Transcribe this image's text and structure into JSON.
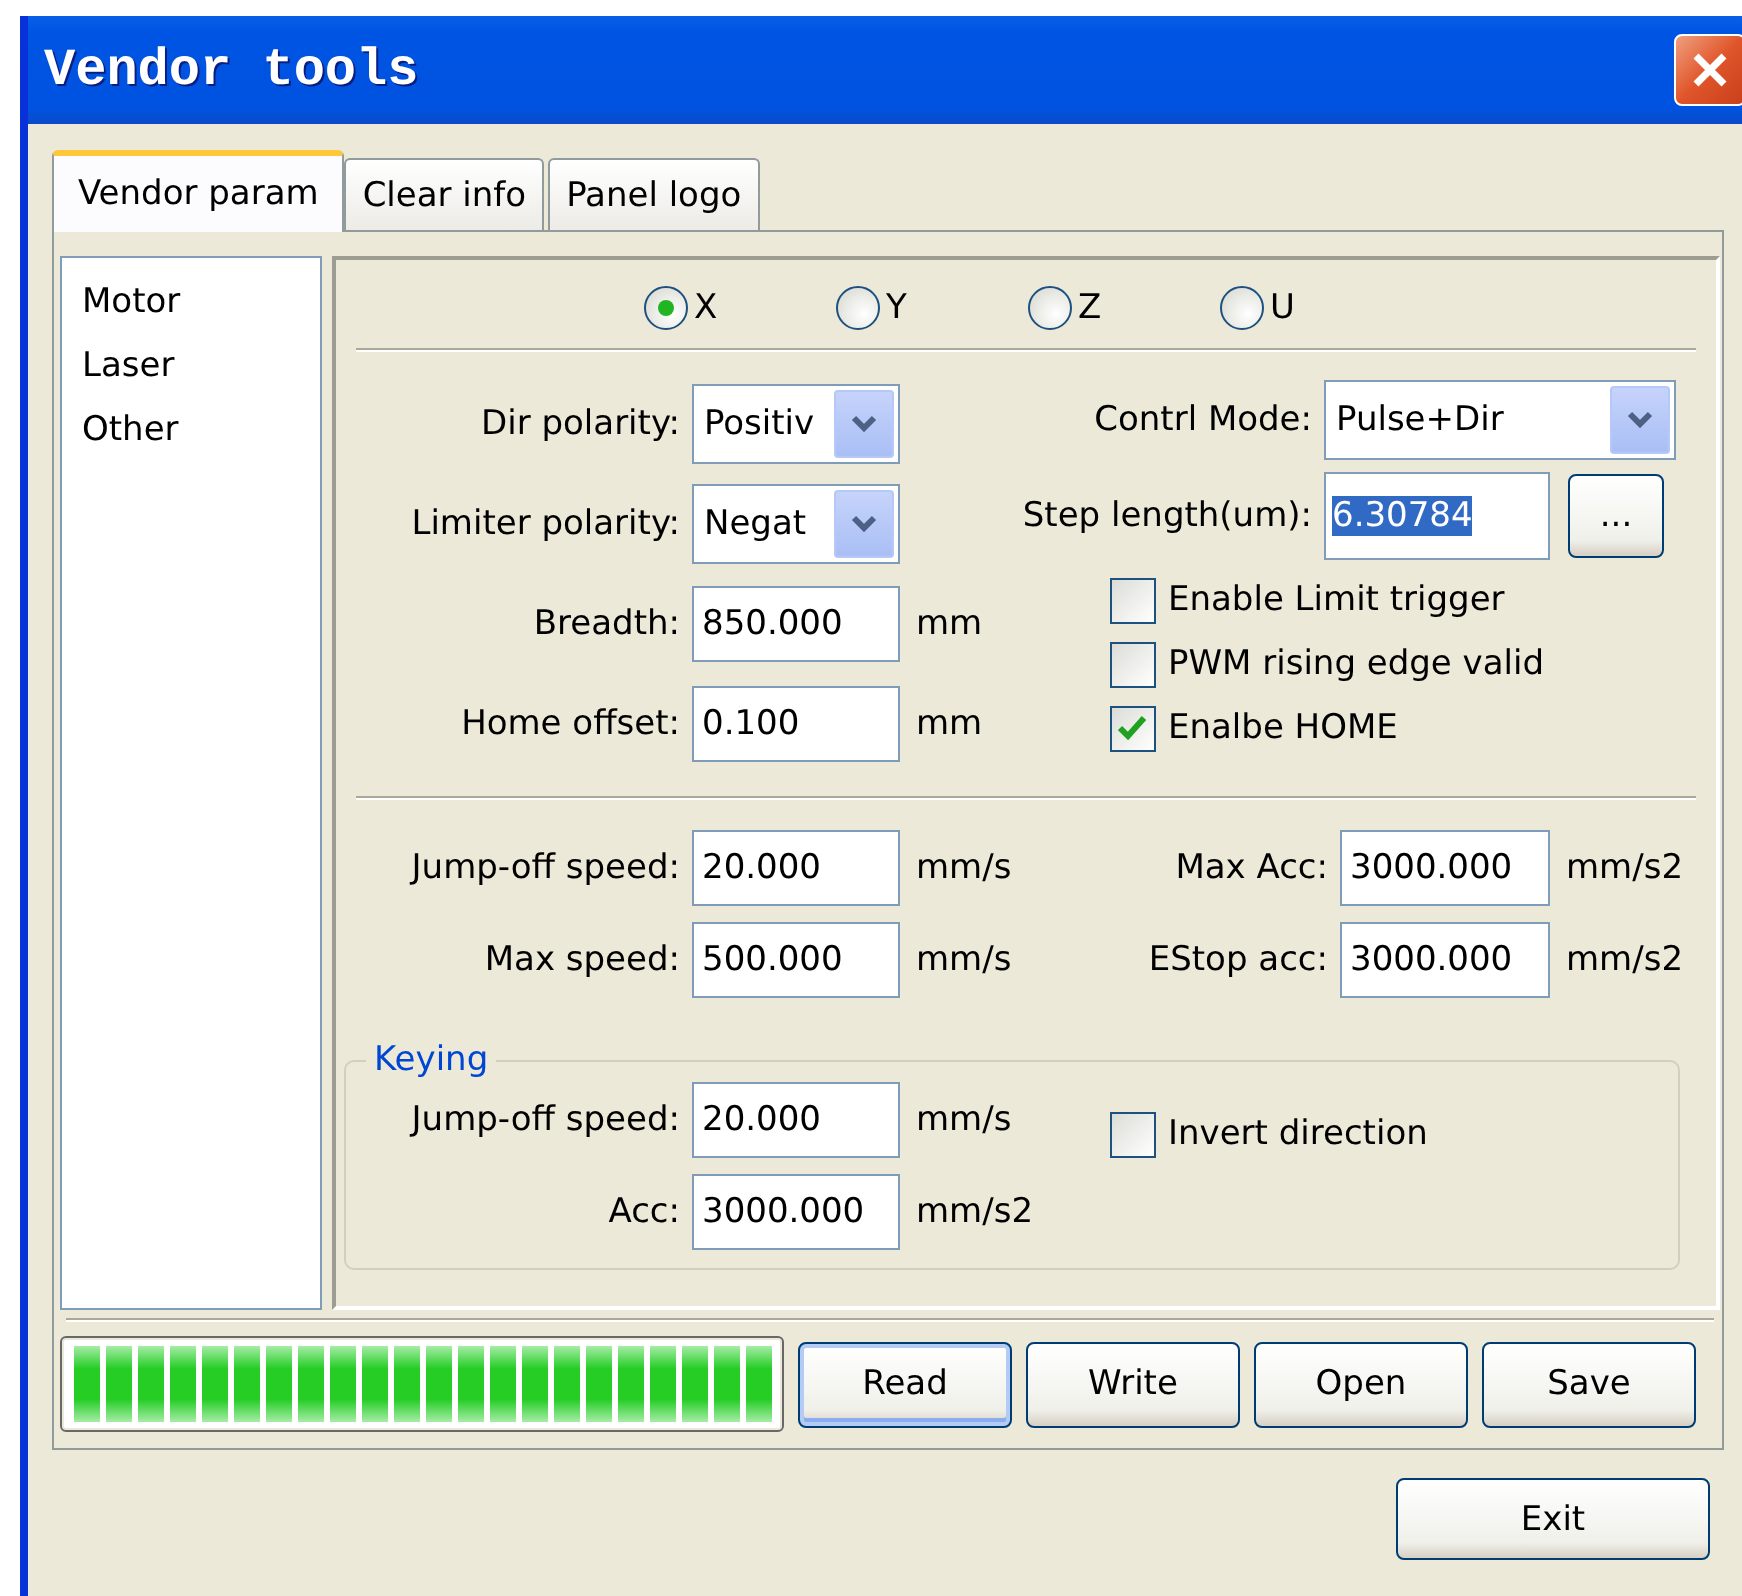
{
  "window": {
    "title": "Vendor tools"
  },
  "tabs": [
    {
      "label": "Vendor param",
      "selected": true
    },
    {
      "label": "Clear info",
      "selected": false
    },
    {
      "label": "Panel logo",
      "selected": false
    }
  ],
  "sidebar": {
    "items": [
      {
        "label": "Motor",
        "selected": false
      },
      {
        "label": "Laser",
        "selected": false
      },
      {
        "label": "Other",
        "selected": false
      }
    ]
  },
  "axes": [
    {
      "label": "X",
      "selected": true
    },
    {
      "label": "Y",
      "selected": false
    },
    {
      "label": "Z",
      "selected": false
    },
    {
      "label": "U",
      "selected": false
    }
  ],
  "motor": {
    "dir_polarity": {
      "label": "Dir polarity:",
      "value": "Positiv"
    },
    "limiter_polarity": {
      "label": "Limiter polarity:",
      "value": "Negat"
    },
    "breadth": {
      "label": "Breadth:",
      "value": "850.000",
      "unit": "mm"
    },
    "home_offset": {
      "label": "Home offset:",
      "value": "0.100",
      "unit": "mm"
    },
    "control_mode": {
      "label": "Contrl Mode:",
      "value": "Pulse+Dir"
    },
    "step_length": {
      "label": "Step length(um):",
      "value": "6.30784",
      "highlighted": true,
      "button": "..."
    },
    "options": [
      {
        "label": "Enable Limit trigger",
        "checked": false
      },
      {
        "label": "PWM rising edge valid",
        "checked": false
      },
      {
        "label": "Enalbe HOME",
        "checked": true
      }
    ]
  },
  "speed": {
    "left": [
      {
        "label": "Jump-off speed:",
        "value": "20.000",
        "unit": "mm/s"
      },
      {
        "label": "Max speed:",
        "value": "500.000",
        "unit": "mm/s"
      }
    ],
    "right": [
      {
        "label": "Max Acc:",
        "value": "3000.000",
        "unit": "mm/s2"
      },
      {
        "label": "EStop acc:",
        "value": "3000.000",
        "unit": "mm/s2"
      }
    ]
  },
  "keying": {
    "title": "Keying",
    "fields": [
      {
        "label": "Jump-off speed:",
        "value": "20.000",
        "unit": "mm/s"
      },
      {
        "label": "Acc:",
        "value": "3000.000",
        "unit": "mm/s2"
      }
    ],
    "invert": {
      "label": "Invert direction",
      "checked": false
    }
  },
  "progress": {
    "level": 1
  },
  "actions": [
    {
      "label": "Read",
      "focused": true
    },
    {
      "label": "Write",
      "focused": false
    },
    {
      "label": "Open",
      "focused": false
    },
    {
      "label": "Save",
      "focused": false
    }
  ],
  "exit": {
    "label": "Exit"
  }
}
